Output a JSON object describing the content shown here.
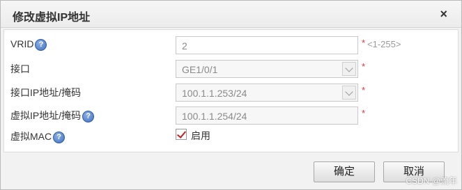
{
  "dialog": {
    "title": "修改虚拟IP地址",
    "close_glyph": "×"
  },
  "form": {
    "vrid": {
      "label": "VRID",
      "value": "2",
      "hint": "<1-255>",
      "required": "*"
    },
    "interface": {
      "label": "接口",
      "value": "GE1/0/1",
      "required": "*"
    },
    "interface_ip": {
      "label": "接口IP地址/掩码",
      "value": "100.1.1.253/24",
      "required": "*"
    },
    "virtual_ip": {
      "label": "虚拟IP地址/掩码",
      "value": "100.1.1.254/24",
      "required": "*"
    },
    "virtual_mac": {
      "label": "虚拟MAC",
      "checkbox_label": "启用",
      "checked": true
    }
  },
  "help_glyph": "?",
  "buttons": {
    "ok": "确定",
    "cancel": "取消"
  },
  "watermark": "CSDN @流年"
}
